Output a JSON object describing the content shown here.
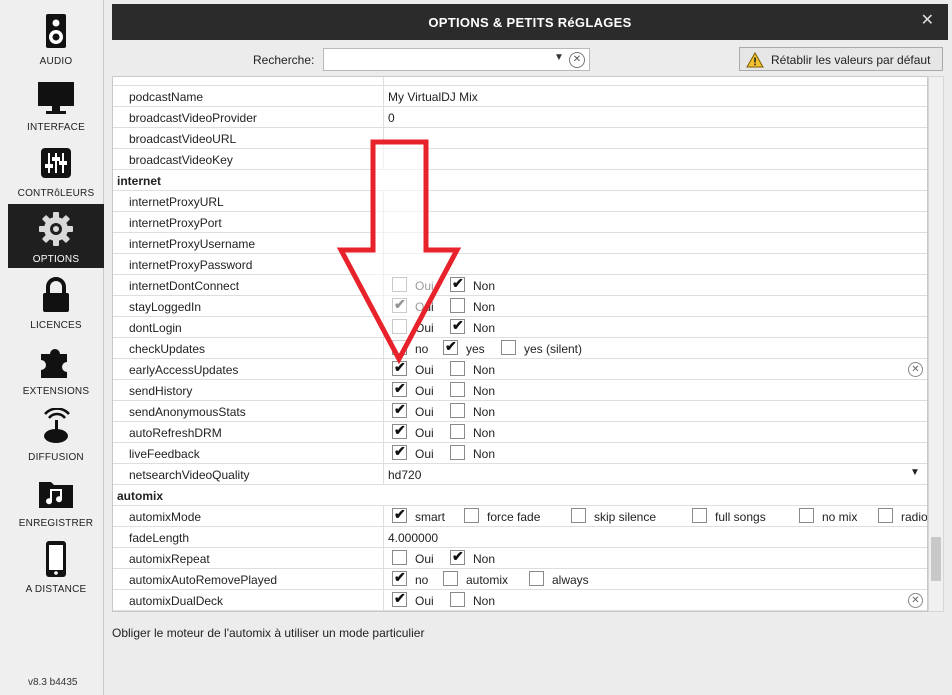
{
  "nav": {
    "items": [
      {
        "label": "AUDIO",
        "icon": "speaker-icon"
      },
      {
        "label": "INTERFACE",
        "icon": "monitor-icon"
      },
      {
        "label": "CONTRôLEURS",
        "icon": "sliders-icon"
      },
      {
        "label": "OPTIONS",
        "icon": "gear-icon"
      },
      {
        "label": "LICENCES",
        "icon": "lock-icon"
      },
      {
        "label": "EXTENSIONS",
        "icon": "puzzle-icon"
      },
      {
        "label": "DIFFUSION",
        "icon": "broadcast-icon"
      },
      {
        "label": "ENREGISTRER",
        "icon": "music-folder-icon"
      },
      {
        "label": "A DISTANCE",
        "icon": "phone-icon"
      }
    ],
    "active": "OPTIONS",
    "version": "v8.3 b4435"
  },
  "window": {
    "title": "OPTIONS & PETITS RéGLAGES",
    "close": "✕"
  },
  "search": {
    "label": "Recherche:",
    "value": "",
    "placeholder": ""
  },
  "reset_button": {
    "label": "Rétablir les valeurs par défaut"
  },
  "rows": [
    {
      "name": "podcastName",
      "value": "My VirtualDJ Mix"
    },
    {
      "name": "broadcastVideoProvider",
      "value": "0"
    },
    {
      "name": "broadcastVideoURL",
      "value": ""
    },
    {
      "name": "broadcastVideoKey",
      "value": ""
    },
    {
      "section": "internet"
    },
    {
      "name": "internetProxyURL",
      "value": ""
    },
    {
      "name": "internetProxyPort",
      "value": ""
    },
    {
      "name": "internetProxyUsername",
      "value": ""
    },
    {
      "name": "internetProxyPassword",
      "value": ""
    },
    {
      "name": "internetDontConnect",
      "options": [
        {
          "label": "Oui",
          "checked": false
        },
        {
          "label": "Non",
          "checked": true
        }
      ]
    },
    {
      "name": "stayLoggedIn",
      "options": [
        {
          "label": "Oui",
          "checked": true
        },
        {
          "label": "Non",
          "checked": false
        }
      ]
    },
    {
      "name": "dontLogin",
      "options": [
        {
          "label": "Oui",
          "checked": false
        },
        {
          "label": "Non",
          "checked": true
        }
      ]
    },
    {
      "name": "checkUpdates",
      "options": [
        {
          "label": "no",
          "checked": false
        },
        {
          "label": "yes",
          "checked": true
        },
        {
          "label": "yes (silent)",
          "checked": false
        }
      ]
    },
    {
      "name": "earlyAccessUpdates",
      "options": [
        {
          "label": "Oui",
          "checked": true
        },
        {
          "label": "Non",
          "checked": false
        }
      ],
      "clear": true
    },
    {
      "name": "sendHistory",
      "options": [
        {
          "label": "Oui",
          "checked": true
        },
        {
          "label": "Non",
          "checked": false
        }
      ]
    },
    {
      "name": "sendAnonymousStats",
      "options": [
        {
          "label": "Oui",
          "checked": true
        },
        {
          "label": "Non",
          "checked": false
        }
      ]
    },
    {
      "name": "autoRefreshDRM",
      "options": [
        {
          "label": "Oui",
          "checked": true
        },
        {
          "label": "Non",
          "checked": false
        }
      ]
    },
    {
      "name": "liveFeedback",
      "options": [
        {
          "label": "Oui",
          "checked": true
        },
        {
          "label": "Non",
          "checked": false
        }
      ]
    },
    {
      "name": "netsearchVideoQuality",
      "value": "hd720",
      "dropdown": true
    },
    {
      "section": "automix"
    },
    {
      "name": "automixMode",
      "options": [
        {
          "label": "smart",
          "checked": true
        },
        {
          "label": "force fade",
          "checked": false
        },
        {
          "label": "skip silence",
          "checked": false
        },
        {
          "label": "full songs",
          "checked": false
        },
        {
          "label": "no mix",
          "checked": false
        },
        {
          "label": "radio",
          "checked": false
        }
      ]
    },
    {
      "name": "fadeLength",
      "value": "4.000000"
    },
    {
      "name": "automixRepeat",
      "options": [
        {
          "label": "Oui",
          "checked": false
        },
        {
          "label": "Non",
          "checked": true
        }
      ]
    },
    {
      "name": "automixAutoRemovePlayed",
      "options": [
        {
          "label": "no",
          "checked": true
        },
        {
          "label": "automix",
          "checked": false
        },
        {
          "label": "always",
          "checked": false
        }
      ]
    },
    {
      "name": "automixDualDeck",
      "options": [
        {
          "label": "Oui",
          "checked": true
        },
        {
          "label": "Non",
          "checked": false
        }
      ],
      "clear": true
    }
  ],
  "description": "Obliger le moteur de l'automix à utiliser un mode particulier",
  "colors": {
    "title_bg": "#2b2b2b",
    "active_nav": "#1f1f1f",
    "arrow": "#e8222b"
  }
}
